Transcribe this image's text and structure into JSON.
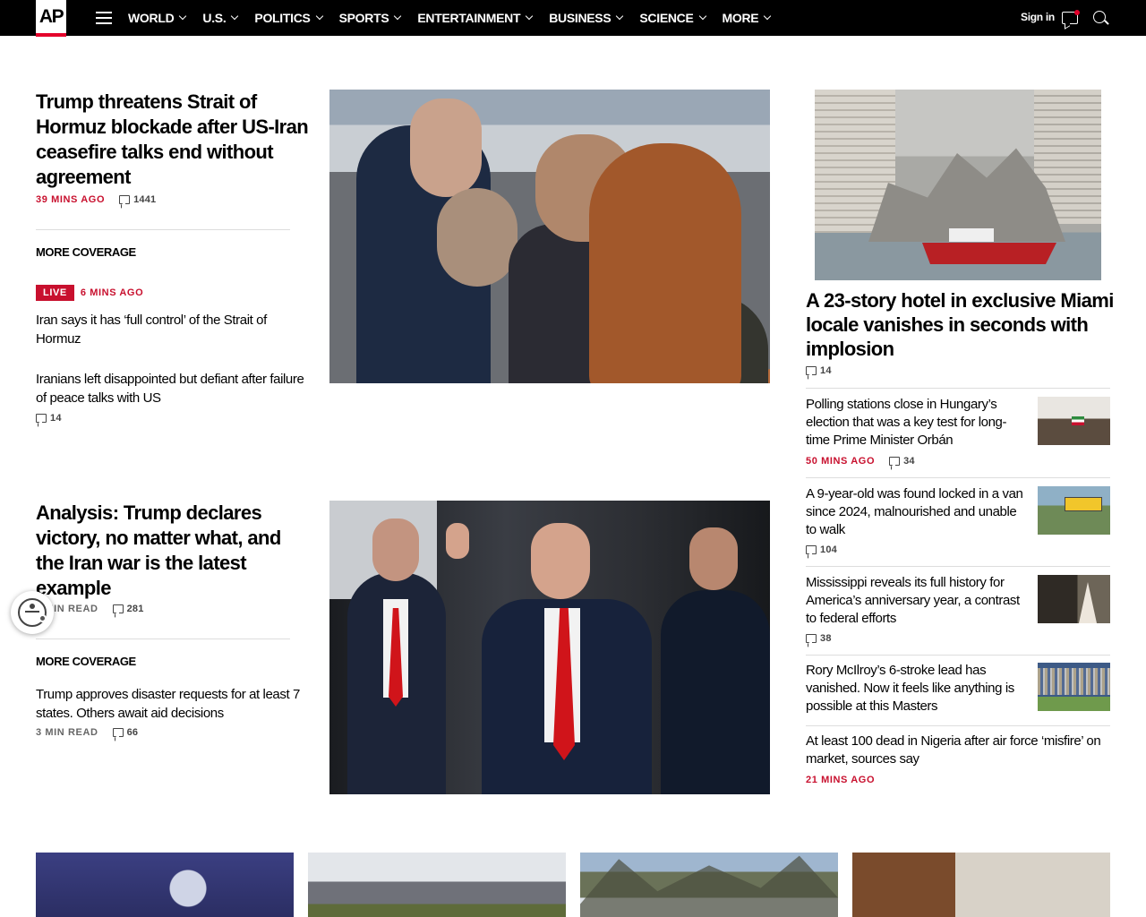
{
  "header": {
    "logo_text": "AP",
    "menu_icon": "hamburger-menu-icon",
    "nav": [
      {
        "label": "WORLD"
      },
      {
        "label": "U.S."
      },
      {
        "label": "POLITICS"
      },
      {
        "label": "SPORTS"
      },
      {
        "label": "ENTERTAINMENT"
      },
      {
        "label": "BUSINESS"
      },
      {
        "label": "SCIENCE"
      },
      {
        "label": "MORE"
      }
    ],
    "signin_label": "Sign in",
    "colors": {
      "bar": "#000000",
      "accent": "#e4002b"
    }
  },
  "top_story": {
    "headline": "Trump threatens Strait of Hormuz blockade after US-Iran ceasefire talks end without agreement",
    "timestamp": "39 MINS AGO",
    "comments": "1441",
    "more_coverage_label": "MORE COVERAGE",
    "live_badge": "LIVE",
    "live_time": "6 MINS AGO",
    "related": [
      {
        "headline": "Iran says it has ‘full control’ of the Strait of Hormuz"
      },
      {
        "headline": "Iranians left disappointed but defiant after failure of peace talks with US",
        "comments": "14"
      }
    ]
  },
  "second_story": {
    "headline": "Analysis: Trump declares victory, no matter what, and the Iran war is the latest example",
    "read_time": "4 MIN READ",
    "comments": "281",
    "more_coverage_label": "MORE COVERAGE",
    "related": [
      {
        "headline": "Trump approves disaster requests for at least 7 states. Others await aid decisions",
        "read_time": "3 MIN READ",
        "comments": "66"
      }
    ]
  },
  "right_column": {
    "feature": {
      "headline": "A 23-story hotel in exclusive Miami locale vanishes in seconds with implosion",
      "comments": "14"
    },
    "stories": [
      {
        "headline": "Polling stations close in Hungary’s election that was a key test for long-time Prime Minister Orbán",
        "timestamp": "50 MINS AGO",
        "comments": "34"
      },
      {
        "headline": "A 9-year-old was found locked in a van since 2024, malnourished and unable to walk",
        "comments": "104"
      },
      {
        "headline": "Mississippi reveals its full history for America’s anniversary year, a contrast to federal efforts",
        "comments": "38"
      },
      {
        "headline": "Rory McIlroy’s 6-stroke lead has vanished. Now it feels like anything is possible at this Masters"
      },
      {
        "headline": "At least 100 dead in Nigeria after air force ‘misfire’ on market, sources say",
        "timestamp": "21 MINS AGO"
      }
    ]
  },
  "accent_red": "#c8102e"
}
